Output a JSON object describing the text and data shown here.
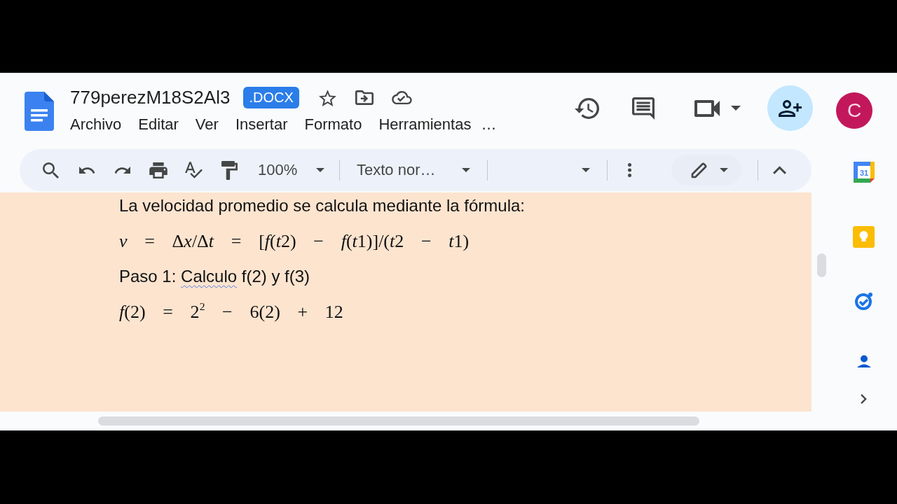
{
  "document_header": {
    "title": "779perezM18S2Al3",
    "format_badge": ".DOCX",
    "menu": [
      "Archivo",
      "Editar",
      "Ver",
      "Insertar",
      "Formato",
      "Herramientas"
    ],
    "menu_more": "…"
  },
  "account": {
    "initial": "C"
  },
  "toolbar": {
    "zoom": "100%",
    "paragraph_style": "Texto nor…"
  },
  "document": {
    "paragraphs": [
      {
        "kind": "text",
        "segments": [
          {
            "text": "La velocidad promedio se calcula mediante la fórmula:",
            "spelling_error": false
          }
        ]
      },
      {
        "kind": "equation",
        "segments": [
          {
            "text": "v",
            "italic": true
          },
          {
            "text": " = Δ",
            "italic": false
          },
          {
            "text": "x",
            "italic": true
          },
          {
            "text": "/Δ",
            "italic": false
          },
          {
            "text": "t",
            "italic": true
          },
          {
            "text": " = [",
            "italic": false
          },
          {
            "text": "f",
            "italic": true
          },
          {
            "text": "(",
            "italic": false
          },
          {
            "text": "t",
            "italic": true
          },
          {
            "text": "2) − ",
            "italic": false
          },
          {
            "text": "f",
            "italic": true
          },
          {
            "text": "(",
            "italic": false
          },
          {
            "text": "t",
            "italic": true
          },
          {
            "text": "1)]/(",
            "italic": false
          },
          {
            "text": "t",
            "italic": true
          },
          {
            "text": "2 − ",
            "italic": false
          },
          {
            "text": "t",
            "italic": true
          },
          {
            "text": "1)",
            "italic": false
          }
        ]
      },
      {
        "kind": "text",
        "segments": [
          {
            "text": "Paso 1: ",
            "spelling_error": false
          },
          {
            "text": "Calculo",
            "spelling_error": true
          },
          {
            "text": " f(2) y f(3)",
            "spelling_error": false
          }
        ]
      },
      {
        "kind": "equation",
        "segments": [
          {
            "text": "f",
            "italic": true
          },
          {
            "text": "(2) = 2$^{2}$ − 6(2) + 12",
            "italic": false
          }
        ]
      }
    ]
  },
  "side_panel": {
    "calendar_day": "31"
  }
}
